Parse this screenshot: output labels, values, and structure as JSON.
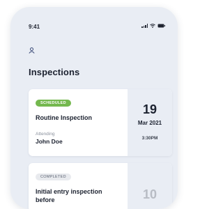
{
  "status_bar": {
    "time": "9:41"
  },
  "header": {
    "title": "Inspections"
  },
  "inspections": [
    {
      "status": "SCHEDULED",
      "title": "Routine Inspection",
      "attending_label": "Attending",
      "attendee": "John Doe",
      "day": "19",
      "month_year": "Mar 2021",
      "time": "3:30PM",
      "status_color": "#74b84e"
    },
    {
      "status": "COMPLETED",
      "title": "Initial entry inspection before",
      "day": "10",
      "status_color": "#e8eaee"
    }
  ],
  "icons": [
    "user-icon",
    "signal-icon",
    "wifi-icon",
    "battery-icon"
  ]
}
